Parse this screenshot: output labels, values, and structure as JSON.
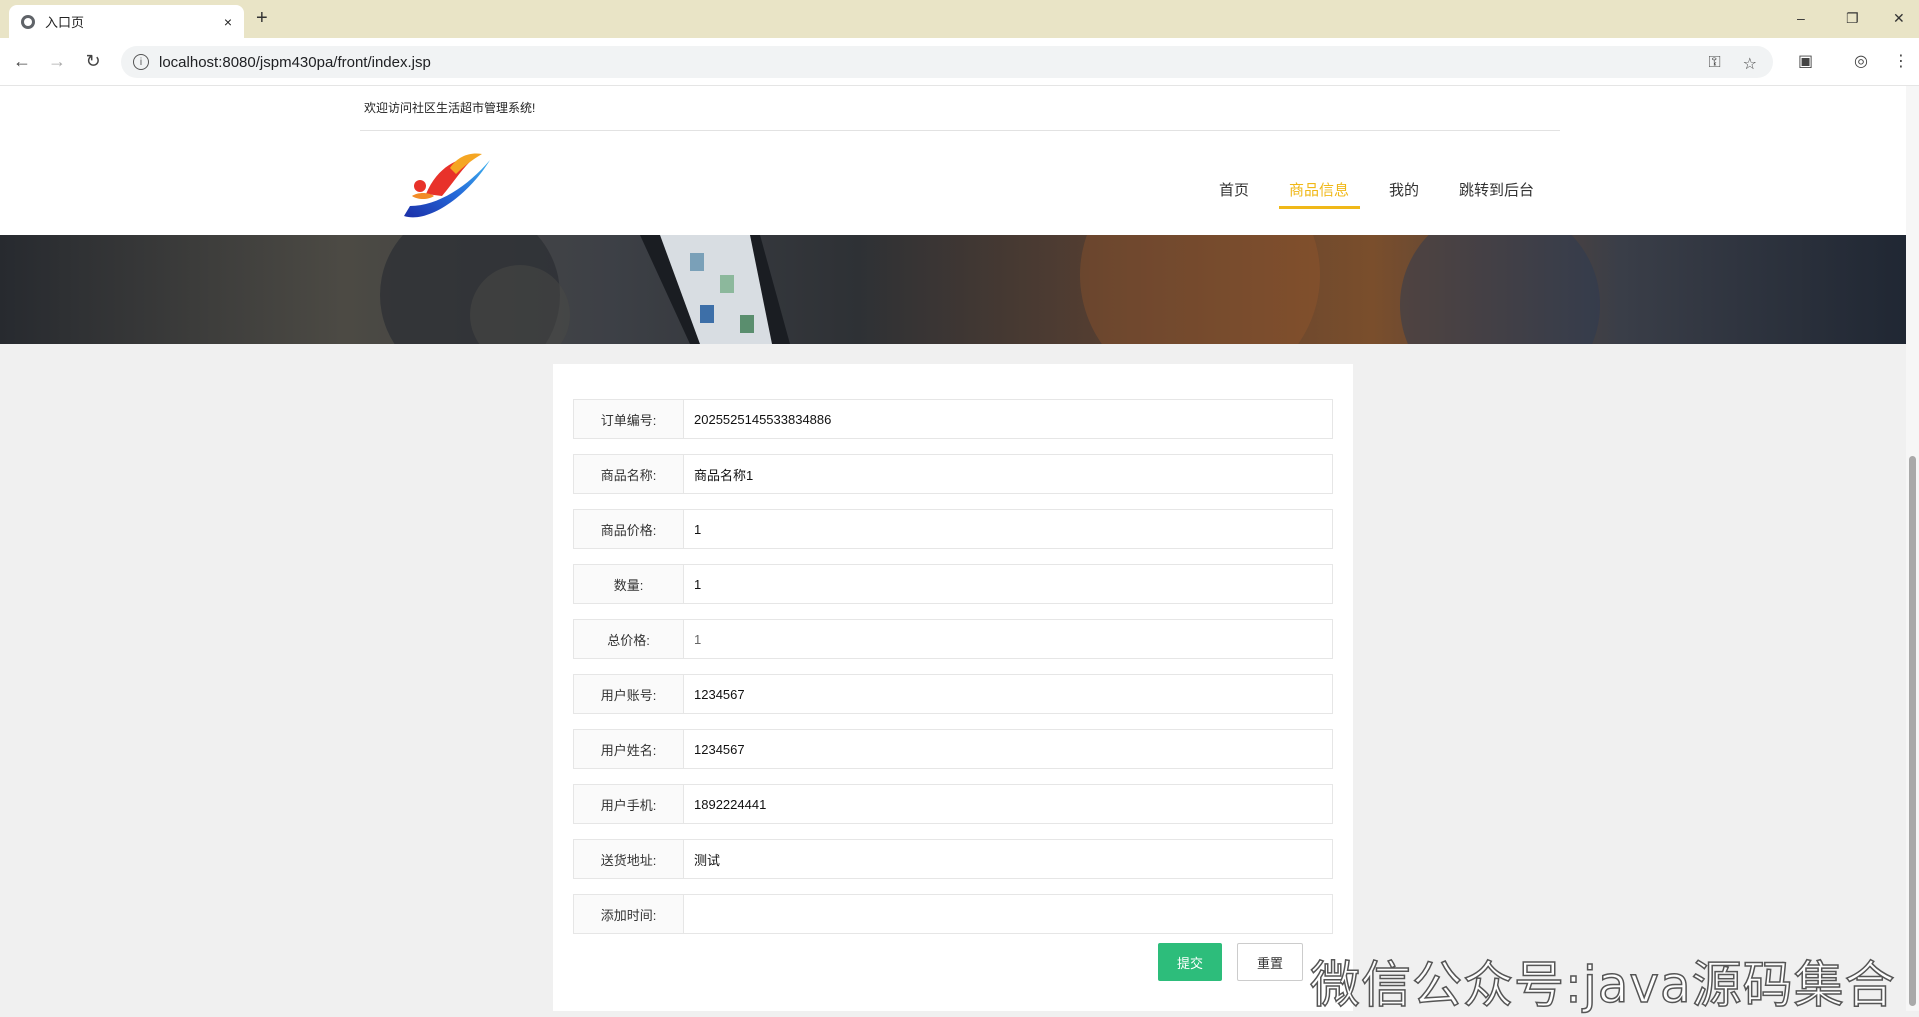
{
  "browser": {
    "tab_title": "入口页",
    "tab_close": "×",
    "new_tab": "+",
    "url": "localhost:8080/jspm430pa/front/index.jsp",
    "back": "←",
    "forward": "→",
    "reload": "↻",
    "minimize": "–",
    "restore": "❐",
    "close": "✕"
  },
  "header": {
    "welcome": "欢迎访问社区生活超市管理系统!",
    "nav": [
      {
        "label": "首页"
      },
      {
        "label": "商品信息",
        "active": true
      },
      {
        "label": "我的"
      },
      {
        "label": "跳转到后台"
      }
    ]
  },
  "form": {
    "fields": [
      {
        "label": "订单编号:",
        "value": "2025525145533834886"
      },
      {
        "label": "商品名称:",
        "value": "商品名称1"
      },
      {
        "label": "商品价格:",
        "value": "1"
      },
      {
        "label": "数量:",
        "value": "1"
      },
      {
        "label": "总价格:",
        "value": "1"
      },
      {
        "label": "用户账号:",
        "value": "1234567"
      },
      {
        "label": "用户姓名:",
        "value": "1234567"
      },
      {
        "label": "用户手机:",
        "value": "1892224441"
      },
      {
        "label": "送货地址:",
        "value": "测试"
      },
      {
        "label": "添加时间:",
        "value": ""
      }
    ],
    "submit_label": "提交",
    "reset_label": "重置"
  },
  "watermark": "微信公众号:java源码集合",
  "colors": {
    "accent": "#f0b818",
    "submit": "#2dbd7b"
  }
}
